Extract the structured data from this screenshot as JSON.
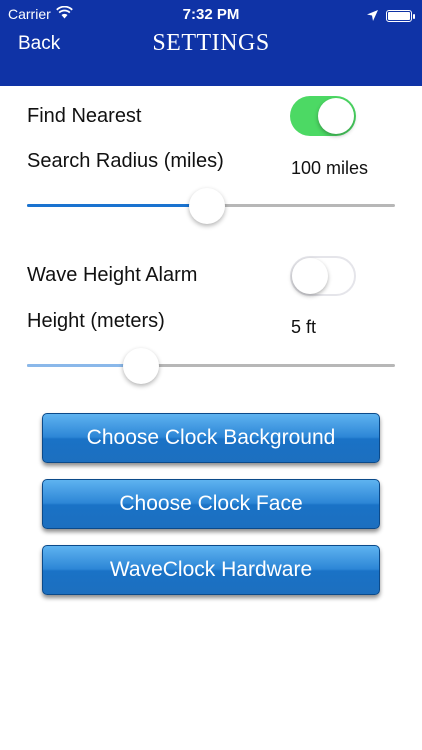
{
  "status_bar": {
    "carrier": "Carrier",
    "time": "7:32 PM",
    "battery_level": 1.0,
    "icons": [
      "wifi-icon",
      "location-arrow-icon",
      "battery-icon"
    ]
  },
  "nav": {
    "back_label": "Back",
    "title": "SETTINGS"
  },
  "settings": {
    "find_nearest": {
      "label": "Find Nearest",
      "enabled": true
    },
    "search_radius": {
      "label": "Search Radius (miles)",
      "value_text": "100 miles",
      "fraction": 0.49
    },
    "wave_alarm": {
      "label": "Wave Height Alarm",
      "enabled": false
    },
    "height": {
      "label": "Height (meters)",
      "value_text": "5 ft",
      "fraction": 0.31
    }
  },
  "buttons": {
    "clock_background": "Choose Clock Background",
    "clock_face": "Choose Clock Face",
    "hardware": "WaveClock Hardware"
  },
  "colors": {
    "header": "#0f33a6",
    "toggle_on": "#4cd964",
    "slider_fill_active": "#1a73d0",
    "slider_fill_inactive": "#8ab8ea"
  }
}
